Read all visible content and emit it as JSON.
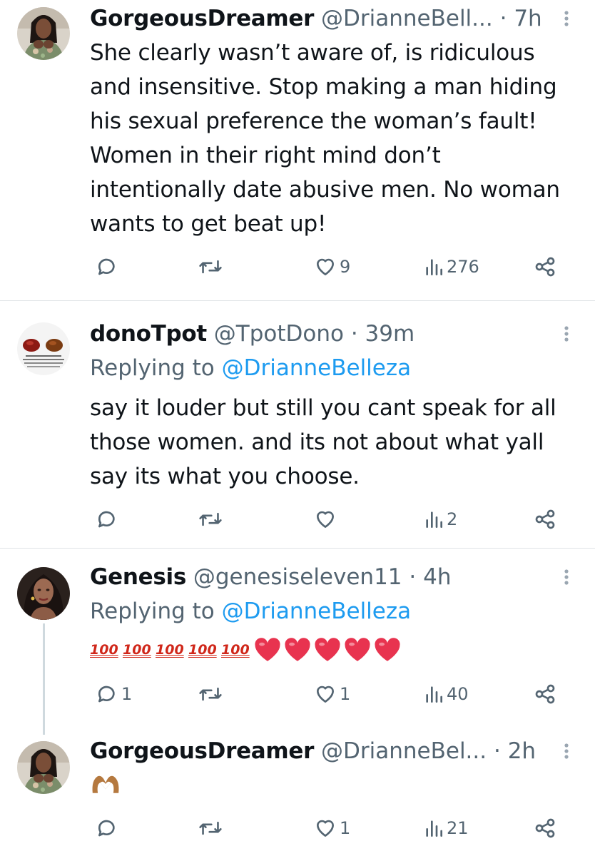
{
  "colors": {
    "text_primary": "#0f1419",
    "text_secondary": "#536471",
    "link": "#1d9bf0",
    "divider": "#dfe3e6",
    "emoji_heart": "#e8334f",
    "emoji_hundred": "#d0271a"
  },
  "tweets": [
    {
      "name": "GorgeousDreamer",
      "handle": "@DrianneBell...",
      "dot": "·",
      "time": "7h",
      "more_icon": "more-vertical-icon",
      "text": "She clearly wasn’t aware of, is ridiculous and insensitive. Stop making a man hiding his sexual preference the woman’s fault! Women in their right mind don’t intentionally date abusive men. No woman wants to get beat up!",
      "replies": "",
      "retweets": "",
      "likes": "9",
      "views": "276"
    },
    {
      "name": "donoTpot",
      "handle": "@TpotDono",
      "dot": "·",
      "time": "39m",
      "more_icon": "more-vertical-icon",
      "replying_prefix": "Replying to",
      "replying_to": "@DrianneBelleza",
      "text": "say it louder but still you cant speak for all those women. and its not about what yall say its what you choose.",
      "replies": "",
      "retweets": "",
      "likes": "",
      "views": "2"
    },
    {
      "name": "Genesis",
      "handle": "@genesiseleven11",
      "dot": "·",
      "time": "4h",
      "more_icon": "more-vertical-icon",
      "replying_prefix": "Replying to",
      "replying_to": "@DrianneBelleza",
      "emojis": [
        "💯",
        "💯",
        "💯",
        "💯",
        "💯",
        "❤️",
        "❤️",
        "❤️",
        "❤️",
        "❤️"
      ],
      "replies": "1",
      "retweets": "",
      "likes": "1",
      "views": "40"
    },
    {
      "name": "GorgeousDreamer",
      "handle": "@DrianneBel...",
      "dot": "·",
      "time": "2h",
      "more_icon": "more-vertical-icon",
      "emojis": [
        "🫶"
      ],
      "replies": "",
      "retweets": "",
      "likes": "1",
      "views": "21"
    }
  ],
  "icons": {
    "reply": "reply-icon",
    "retweet": "retweet-icon",
    "like": "heart-icon",
    "views": "views-icon",
    "share": "share-icon"
  }
}
